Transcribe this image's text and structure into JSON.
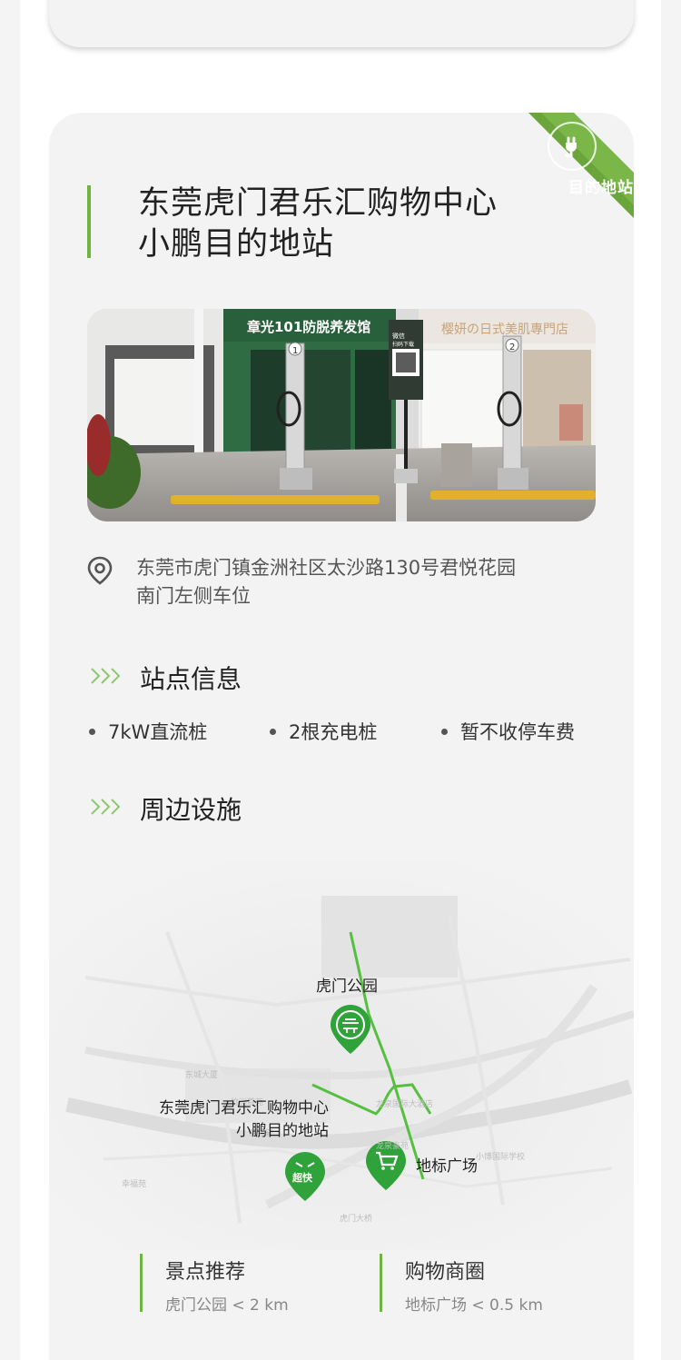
{
  "badge": {
    "label": "目的地站",
    "icon": "plug-icon"
  },
  "station": {
    "name_line1": "东莞虎门君乐汇购物中心",
    "name_line2": "小鹏目的地站"
  },
  "photo": {
    "shop_sign_left": "章光101防脱养发馆",
    "shop_sign_right": "樱妍の日式美肌專門店",
    "qr_caption_top": "微信",
    "qr_caption_bottom": "扫码下载",
    "charger_left_number": "1",
    "charger_right_number": "2"
  },
  "address": {
    "line1": "东莞市虎门镇金洲社区太沙路130号君悦花园",
    "line2": "南门左侧车位"
  },
  "sections": {
    "info_title": "站点信息",
    "facilities_title": "周边设施"
  },
  "info": {
    "item1": "7kW直流桩",
    "item2": "2根充电桩",
    "item3": "暂不收停车费"
  },
  "map": {
    "park_label": "虎门公园",
    "station_label_line1": "东莞虎门君乐汇购物中心",
    "station_label_line2": "小鹏目的地站",
    "mall_label": "地标广场",
    "station_pin_text": "超快",
    "route_color": "#55c040",
    "pin_color": "#2fa33a"
  },
  "recommend": {
    "scenic_title": "景点推荐",
    "scenic_sub": "虎门公园 < 2 km",
    "shopping_title": "购物商圈",
    "shopping_sub": "地标广场 < 0.5 km"
  },
  "colors": {
    "accent": "#6eb43f",
    "card_bg": "#f3f3f3",
    "text": "#222222"
  }
}
